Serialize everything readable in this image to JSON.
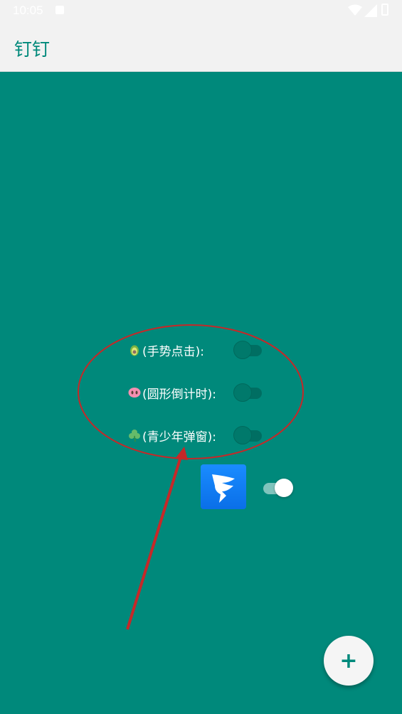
{
  "status_bar": {
    "time": "10:05"
  },
  "app_bar": {
    "title": "钉钉"
  },
  "toggles": [
    {
      "label": "(手势点击):",
      "icon": "avocado-icon",
      "checked": false
    },
    {
      "label": "(圆形倒计时):",
      "icon": "pig-nose-icon",
      "checked": false
    },
    {
      "label": "(青少年弹窗):",
      "icon": "shamrock-icon",
      "checked": false
    }
  ],
  "app_toggle": {
    "icon": "dingtalk-logo-icon",
    "checked": true
  },
  "fab": {
    "label": "+"
  },
  "colors": {
    "accent": "#00897b",
    "appbar": "#f2f2f2",
    "annotation_red": "#c62828",
    "dingtalk_blue": "#1a8cff"
  }
}
